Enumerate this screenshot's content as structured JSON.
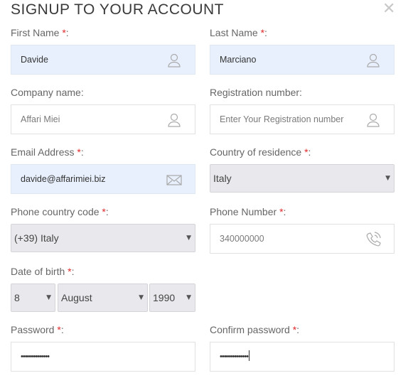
{
  "header": {
    "title": "SIGNUP TO YOUR ACCOUNT",
    "close_glyph": "✕",
    "close_icon": "close-icon"
  },
  "form": {
    "first_name": {
      "label": "First Name",
      "required": "*",
      "colon": ":",
      "value": "Davide",
      "icon": "user-icon"
    },
    "last_name": {
      "label": "Last Name",
      "required": "*",
      "colon": ":",
      "value": "Marciano",
      "icon": "user-icon"
    },
    "company": {
      "label": "Company name:",
      "placeholder": "Affari Miei",
      "icon": "user-icon"
    },
    "registration": {
      "label": "Registration number:",
      "placeholder": "Enter Your Registration number",
      "icon": "user-icon"
    },
    "email": {
      "label": "Email Address",
      "required": "*",
      "colon": ":",
      "value": "davide@affarimiei.biz",
      "icon": "envelope-icon"
    },
    "country": {
      "label": "Country of residence",
      "required": "*",
      "colon": ":",
      "selected": "Italy"
    },
    "phone_code": {
      "label": "Phone country code",
      "required": "*",
      "colon": ":",
      "selected": "(+39) Italy"
    },
    "phone": {
      "label": "Phone Number",
      "required": "*",
      "colon": ":",
      "placeholder": "340000000",
      "icon": "phone-icon"
    },
    "dob": {
      "label": "Date of birth",
      "required": "*",
      "colon": ":",
      "day": "8",
      "month": "August",
      "year": "1990"
    },
    "password": {
      "label": "Password",
      "required": "*",
      "colon": ":",
      "value": "••••••••••••••"
    },
    "confirm_password": {
      "label": "Confirm password",
      "required": "*",
      "colon": ":",
      "value": "••••••••••••••"
    }
  },
  "caret_glyph": "▼",
  "colors": {
    "required": "#e0292a",
    "autofill_bg": "#e8f0fd",
    "select_bg": "#e9e9ed"
  }
}
